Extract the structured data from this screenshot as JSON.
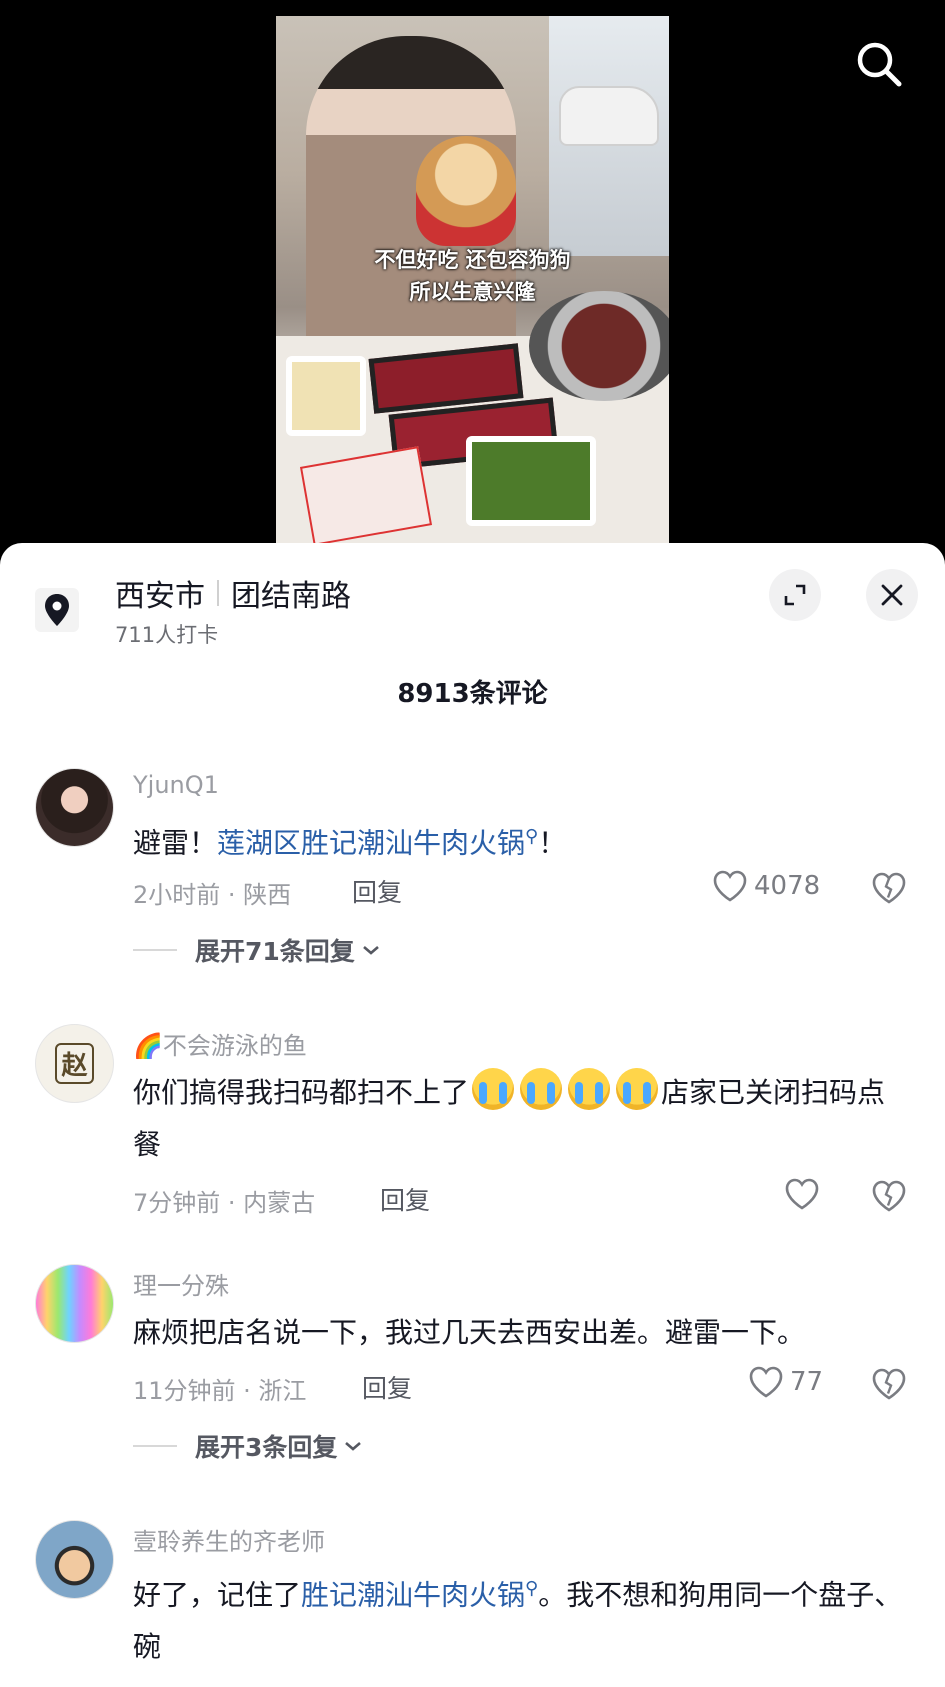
{
  "video": {
    "caption_line1": "不但好吃 还包容狗狗",
    "caption_line2": "所以生意兴隆"
  },
  "location": {
    "city": "西安市",
    "road": "团结南路",
    "checkins": "711人打卡"
  },
  "comments_header": "8913条评论",
  "comments": [
    {
      "username": "YjunQ1",
      "text_prefix": "避雷！",
      "link": "莲湖区胜记潮汕牛肉火锅",
      "text_suffix": "！",
      "meta": "2小时前 · 陕西",
      "reply": "回复",
      "likes": "4078",
      "expand": "展开71条回复"
    },
    {
      "username_emoji": "🌈",
      "username": "不会游泳的鱼",
      "text_before": "你们搞得我扫码都扫不上了",
      "text_after": "店家已关闭扫码点餐",
      "meta": "7分钟前 · 内蒙古",
      "reply": "回复",
      "avatar_text": "赵"
    },
    {
      "username": "理一分殊",
      "text": "麻烦把店名说一下，我过几天去西安出差。避雷一下。",
      "meta": "11分钟前 · 浙江",
      "reply": "回复",
      "likes": "77",
      "expand": "展开3条回复"
    },
    {
      "username": "壹聆养生的齐老师",
      "text_prefix": "好了，记住了",
      "link": "胜记潮汕牛肉火锅",
      "text_suffix": "。我不想和狗用同一个盘子、碗"
    }
  ],
  "colors": {
    "link": "#2a5fa8",
    "muted": "#9a9ca2",
    "text": "#161823"
  }
}
